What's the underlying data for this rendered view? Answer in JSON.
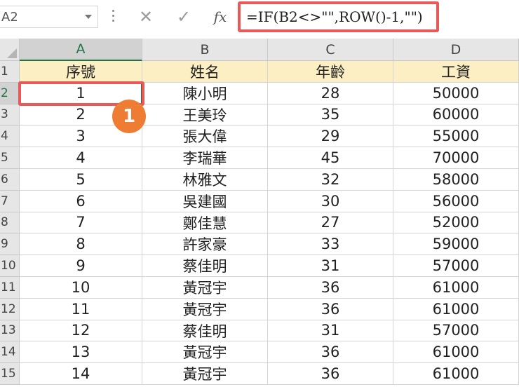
{
  "formula_bar": {
    "name_box": "A2",
    "cancel_symbol": "✕",
    "enter_symbol": "✓",
    "fx_label": "fx",
    "formula": "=IF(B2<>\"\",ROW()-1,\"\")"
  },
  "sheet": {
    "columns": [
      "A",
      "B",
      "C",
      "D"
    ],
    "selected_cell": "A2",
    "row_numbers": [
      "1",
      "2",
      "3",
      "4",
      "5",
      "6",
      "7",
      "8",
      "9",
      "10",
      "11",
      "12",
      "13",
      "14",
      "15"
    ],
    "header_row": [
      "序號",
      "姓名",
      "年齡",
      "工資"
    ],
    "rows": [
      [
        "1",
        "陳小明",
        "28",
        "50000"
      ],
      [
        "2",
        "王美玲",
        "35",
        "60000"
      ],
      [
        "3",
        "張大偉",
        "29",
        "55000"
      ],
      [
        "4",
        "李瑞華",
        "45",
        "70000"
      ],
      [
        "5",
        "林雅文",
        "32",
        "58000"
      ],
      [
        "6",
        "吳建國",
        "30",
        "56000"
      ],
      [
        "7",
        "鄭佳慧",
        "27",
        "52000"
      ],
      [
        "8",
        "許家豪",
        "33",
        "59000"
      ],
      [
        "9",
        "蔡佳明",
        "31",
        "57000"
      ],
      [
        "10",
        "黃冠宇",
        "36",
        "61000"
      ],
      [
        "11",
        "黃冠宇",
        "36",
        "61000"
      ],
      [
        "12",
        "蔡佳明",
        "31",
        "57000"
      ],
      [
        "13",
        "黃冠宇",
        "36",
        "61000"
      ],
      [
        "14",
        "黃冠宇",
        "36",
        "61000"
      ]
    ]
  },
  "annotation": {
    "step_number": "1",
    "highlight_color": "#e85a5a",
    "badge_color": "#ee7d33"
  },
  "colors": {
    "header_fill": "#fdefc4",
    "selection": "#217346"
  }
}
